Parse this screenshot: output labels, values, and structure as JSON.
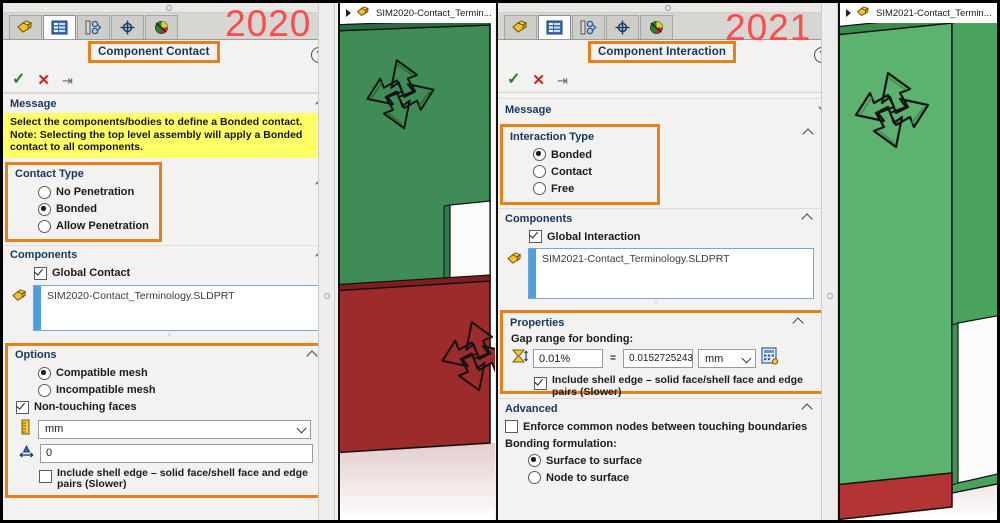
{
  "meta": {
    "year_left": "2020",
    "year_right": "2021",
    "accent_highlight": "#e8801a",
    "year_color": "#ff4a4a",
    "message_bg": "#ffff66"
  },
  "left": {
    "tabs": [
      {
        "name": "model-tab",
        "icon": "part-icon"
      },
      {
        "name": "simulation-study-tab",
        "icon": "study-list-icon"
      },
      {
        "name": "configuration-tab",
        "icon": "configuration-icon"
      },
      {
        "name": "display-manager-tab",
        "icon": "crosshair-icon"
      },
      {
        "name": "appearances-tab",
        "icon": "appearance-sphere-icon"
      }
    ],
    "title": "Component Contact",
    "help_label": "?",
    "ok_label": "✓",
    "cancel_label": "✕",
    "pin_label": "⇥",
    "sections": {
      "message": {
        "header": "Message",
        "collapsed": false,
        "text": "Select the components/bodies to define a Bonded contact. Note: Selecting the top level assembly will apply a Bonded contact to all components."
      },
      "contact_type": {
        "header": "Contact Type",
        "highlighted": true,
        "options": [
          {
            "label": "No Penetration",
            "selected": false
          },
          {
            "label": "Bonded",
            "selected": true
          },
          {
            "label": "Allow Penetration",
            "selected": false
          }
        ]
      },
      "components": {
        "header": "Components",
        "checkbox": {
          "label": "Global Contact",
          "checked": true
        },
        "selection": "SIM2020-Contact_Terminology.SLDPRT"
      },
      "options": {
        "header": "Options",
        "highlighted": true,
        "mesh_options": [
          {
            "label": "Compatible mesh",
            "selected": true
          },
          {
            "label": "Incompatible mesh",
            "selected": false
          }
        ],
        "non_touching": {
          "label": "Non-touching faces",
          "checked": true
        },
        "unit_value": "mm",
        "gap_value": "0",
        "shell_edge": {
          "label": "Include shell edge – solid face/shell face and edge pairs (Slower)",
          "checked": false
        }
      }
    }
  },
  "right": {
    "tabs": [
      {
        "name": "model-tab",
        "icon": "part-icon"
      },
      {
        "name": "simulation-study-tab",
        "icon": "study-list-icon"
      },
      {
        "name": "configuration-tab",
        "icon": "configuration-icon"
      },
      {
        "name": "display-manager-tab",
        "icon": "crosshair-icon"
      },
      {
        "name": "appearances-tab",
        "icon": "appearance-sphere-icon"
      }
    ],
    "title": "Component Interaction",
    "help_label": "?",
    "ok_label": "✓",
    "cancel_label": "✕",
    "pin_label": "⇥",
    "sections": {
      "message": {
        "header": "Message",
        "collapsed": true
      },
      "interaction_type": {
        "header": "Interaction Type",
        "highlighted": true,
        "options": [
          {
            "label": "Bonded",
            "selected": true
          },
          {
            "label": "Contact",
            "selected": false
          },
          {
            "label": "Free",
            "selected": false
          }
        ]
      },
      "components": {
        "header": "Components",
        "checkbox": {
          "label": "Global Interaction",
          "checked": true
        },
        "selection": "SIM2021-Contact_Terminology.SLDPRT"
      },
      "properties": {
        "header": "Properties",
        "highlighted": true,
        "gap_label": "Gap range for bonding:",
        "percent_value": "0.01%",
        "equals": "=",
        "absolute_value": "0.0152725243",
        "unit_value": "mm",
        "calculator_icon": "calculator-icon",
        "shell_edge": {
          "label": "Include shell edge – solid face/shell face and edge pairs (Slower)",
          "checked": true
        }
      },
      "advanced": {
        "header": "Advanced",
        "enforce": {
          "label": "Enforce common nodes between touching boundaries",
          "checked": false
        },
        "formulation_label": "Bonding formulation:",
        "formulation_options": [
          {
            "label": "Surface to surface",
            "selected": true
          },
          {
            "label": "Node to surface",
            "selected": false
          }
        ]
      }
    }
  },
  "viewport_left": {
    "tab_title": "SIM2020-Contact_Termin...",
    "tree_icon": "part-icon",
    "expand_icon": "triangle-right-icon",
    "green_color": "#3f8c57",
    "red_color": "#9e2b2b"
  },
  "viewport_right": {
    "tab_title": "SIM2021-Contact_Termin...",
    "tree_icon": "part-icon",
    "expand_icon": "triangle-right-icon",
    "green_color": "#5cb36f",
    "red_color": "#b23434"
  }
}
